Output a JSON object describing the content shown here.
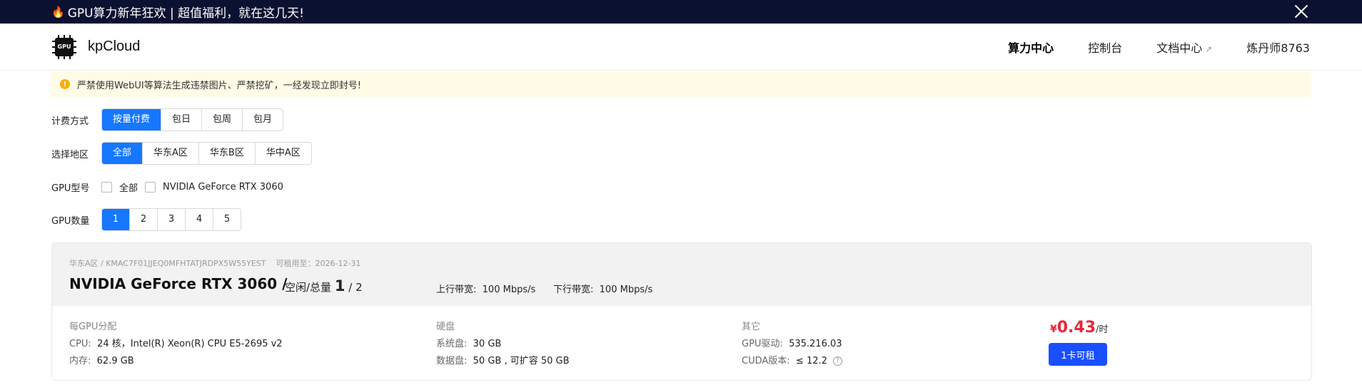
{
  "promo": {
    "text": "GPU算力新年狂欢 | 超值福利，就在这几天!"
  },
  "nav": {
    "logo_chip": "GPU",
    "logo_name": "kpCloud",
    "links": [
      "算力中心",
      "控制台",
      "文档中心",
      "炼丹师8763"
    ],
    "external_glyph": "↗"
  },
  "warning": {
    "icon": "!",
    "text": "严禁使用WebUI等算法生成违禁图片、严禁挖矿，一经发现立即封号!"
  },
  "filters": {
    "billing": {
      "label": "计费方式",
      "options": [
        "按量付费",
        "包日",
        "包周",
        "包月"
      ],
      "selected": "按量付费"
    },
    "region": {
      "label": "选择地区",
      "options": [
        "全部",
        "华东A区",
        "华东B区",
        "华中A区"
      ],
      "selected": "全部"
    },
    "gpu_model": {
      "label": "GPU型号",
      "options": [
        "全部",
        "NVIDIA GeForce RTX 3060"
      ]
    },
    "gpu_count": {
      "label": "GPU数量",
      "options": [
        "1",
        "2",
        "3",
        "4",
        "5"
      ],
      "selected": "1"
    }
  },
  "card": {
    "meta": "华东A区 / KMAC7F01JJEQ0MFHTATJRDPX5W55YEST",
    "available_until": "可租用至：2026-12-31",
    "gpu_name": "NVIDIA GeForce RTX 3060 /",
    "free_label": "空闲/总量",
    "free_count": "1",
    "total_count": "/ 2",
    "upload_label": "上行带宽:",
    "upload_value": "100 Mbps/s",
    "download_label": "下行带宽:",
    "download_value": "100 Mbps/s",
    "per_gpu_title": "每GPU分配",
    "cpu_label": "CPU:",
    "cpu_value": "24 核，Intel(R) Xeon(R) CPU E5-2695 v2",
    "mem_label": "内存:",
    "mem_value": "62.9 GB",
    "disk_title": "硬盘",
    "sys_disk_label": "系统盘:",
    "sys_disk_value": "30 GB",
    "data_disk_label": "数据盘:",
    "data_disk_value": "50 GB , 可扩容 50 GB",
    "other_title": "其它",
    "driver_label": "GPU驱动:",
    "driver_value": "535.216.03",
    "cuda_label": "CUDA版本:",
    "cuda_value": "≤ 12.2",
    "help_glyph": "?",
    "price_currency": "¥",
    "price_value": "0.43",
    "price_unit": "/时",
    "rent_button": "1卡可租"
  },
  "colors": {
    "primary": "#1677ff",
    "price": "#e8273b",
    "promo_bg": "#0b1130",
    "warn_bg": "#fffbe6"
  }
}
